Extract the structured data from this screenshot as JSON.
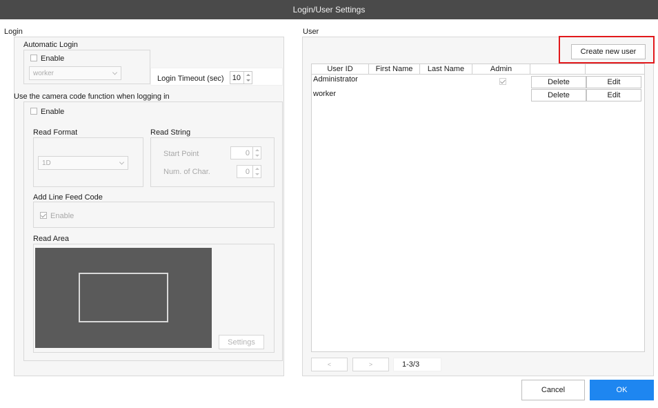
{
  "window": {
    "title": "Login/User Settings"
  },
  "login": {
    "section_label": "Login",
    "automatic_login": {
      "label": "Automatic Login",
      "enable_label": "Enable",
      "enabled": false,
      "user_select_value": "worker",
      "timeout_label": "Login Timeout (sec)",
      "timeout_value": "10"
    },
    "camera_code": {
      "label": "Use the camera code function when logging in",
      "enable_label": "Enable",
      "enabled": false,
      "read_format": {
        "label": "Read Format",
        "value": "1D"
      },
      "read_string": {
        "label": "Read String",
        "start_point_label": "Start Point",
        "start_point_value": "0",
        "num_char_label": "Num. of Char.",
        "num_char_value": "0"
      },
      "line_feed": {
        "label": "Add Line Feed Code",
        "enable_label": "Enable",
        "enabled": true
      },
      "read_area": {
        "label": "Read Area",
        "settings_label": "Settings"
      }
    }
  },
  "user": {
    "section_label": "User",
    "create_button_label": "Create new user",
    "columns": [
      "User ID",
      "First Name",
      "Last Name",
      "Admin"
    ],
    "rows": [
      {
        "user_id": "Administrator",
        "first_name": "",
        "last_name": "",
        "admin": true,
        "delete_label": "Delete",
        "edit_label": "Edit"
      },
      {
        "user_id": "worker",
        "first_name": "",
        "last_name": "",
        "admin": false,
        "delete_label": "Delete",
        "edit_label": "Edit"
      }
    ],
    "pagination": {
      "prev_glyph": "<",
      "next_glyph": ">",
      "range": "1-3/3"
    }
  },
  "footer": {
    "cancel_label": "Cancel",
    "ok_label": "OK"
  },
  "colors": {
    "highlight": "#e2181b",
    "primary": "#1e86f0",
    "titlebar": "#4a4a4a"
  }
}
